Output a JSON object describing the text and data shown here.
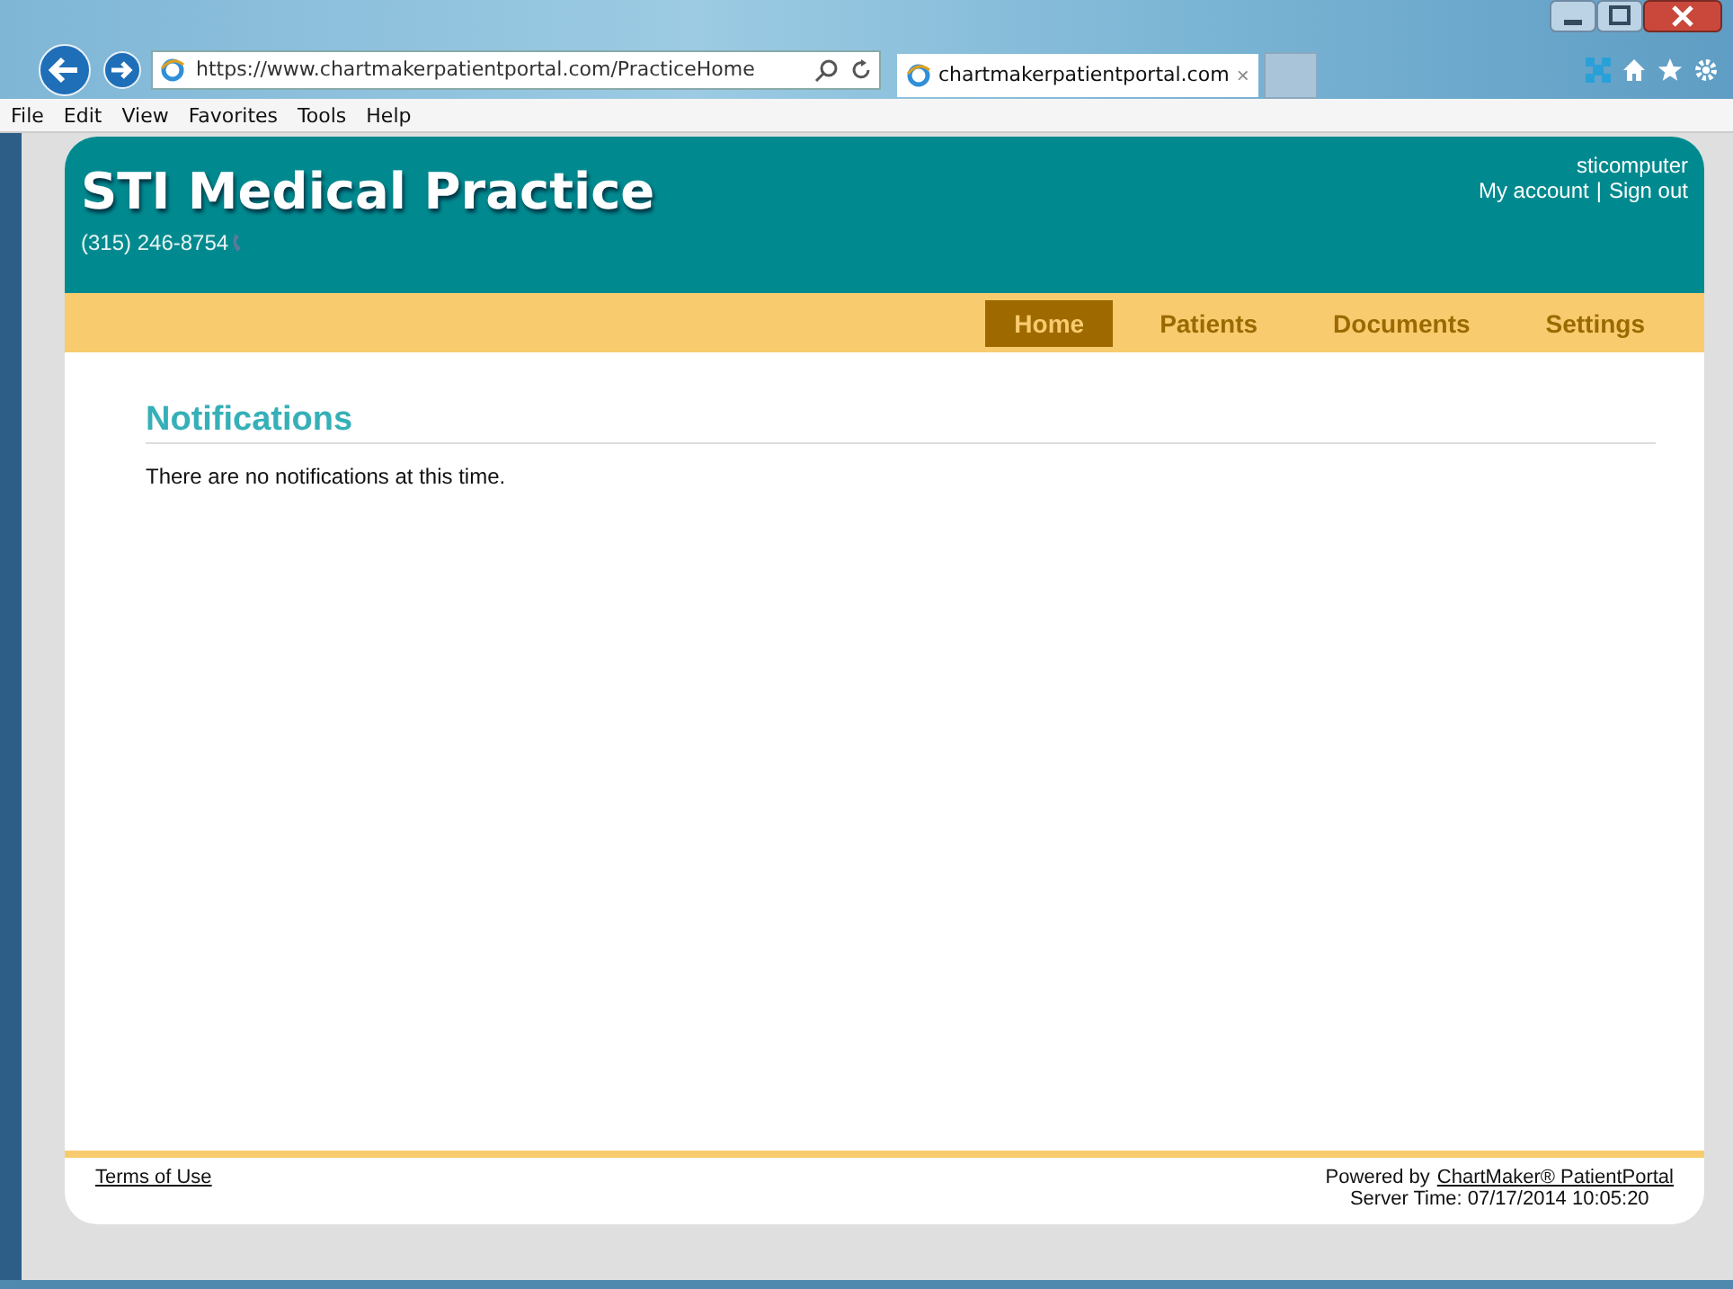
{
  "browser": {
    "url": "https://www.chartmakerpatientportal.com/PracticeHome",
    "tab_title": "chartmakerpatientportal.com",
    "tab_close": "×",
    "menu": [
      "File",
      "Edit",
      "View",
      "Favorites",
      "Tools",
      "Help"
    ]
  },
  "header": {
    "title": "STI Medical Practice",
    "phone": "(315) 246-8754",
    "username": "sticomputer",
    "account_link": "My account",
    "separator": "|",
    "signout_link": "Sign out"
  },
  "nav": [
    {
      "label": "Home",
      "selected": true
    },
    {
      "label": "Patients",
      "selected": false
    },
    {
      "label": "Documents",
      "selected": false
    },
    {
      "label": "Settings",
      "selected": false
    }
  ],
  "content": {
    "heading": "Notifications",
    "message": "There are no notifications at this time."
  },
  "footer": {
    "terms": "Terms of Use",
    "powered_prefix": "Powered by",
    "powered_link": "ChartMaker® PatientPortal",
    "server_time": "Server Time: 07/17/2014 10:05:20"
  }
}
